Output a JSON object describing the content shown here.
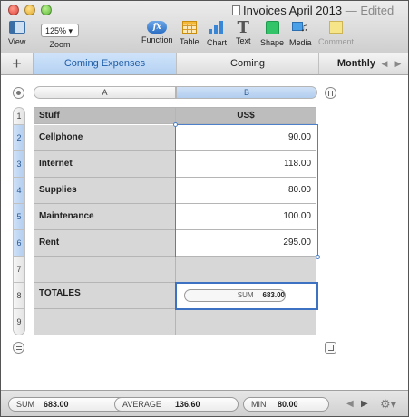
{
  "window": {
    "title": "Invoices April 2013",
    "status": "— Edited"
  },
  "toolbar": {
    "view_label": "View",
    "zoom_value": "125% ▾",
    "zoom_label": "Zoom",
    "function_label": "Function",
    "function_glyph": "fx",
    "table_label": "Table",
    "chart_label": "Chart",
    "text_label": "Text",
    "text_glyph": "T",
    "shape_label": "Shape",
    "media_label": "Media",
    "comment_label": "Comment"
  },
  "tabs": {
    "add_glyph": "+",
    "items": [
      {
        "label": "Coming Expenses",
        "active": true
      },
      {
        "label": "Coming",
        "active": false
      },
      {
        "label": "Monthly",
        "active": false
      }
    ],
    "prev_glyph": "◀",
    "next_glyph": "▶"
  },
  "sheet": {
    "columns": [
      "A",
      "B"
    ],
    "rows": [
      "1",
      "2",
      "3",
      "4",
      "5",
      "6",
      "7",
      "8",
      "9"
    ],
    "header": {
      "stuff": "Stuff",
      "currency": "US$"
    },
    "items": [
      {
        "name": "Cellphone",
        "amount": "90.00"
      },
      {
        "name": "Internet",
        "amount": "118.00"
      },
      {
        "name": "Supplies",
        "amount": "80.00"
      },
      {
        "name": "Maintenance",
        "amount": "100.00"
      },
      {
        "name": "Rent",
        "amount": "295.00"
      }
    ],
    "totals_label": "TOTALES",
    "totals_formula": {
      "fn": "SUM",
      "value": "683.00"
    }
  },
  "status": {
    "sum": {
      "label": "SUM",
      "value": "683.00"
    },
    "average": {
      "label": "AVERAGE",
      "value": "136.60"
    },
    "min": {
      "label": "MIN",
      "value": "80.00"
    },
    "prev_glyph": "◀",
    "next_glyph": "▶",
    "gear_glyph": "⚙▾"
  },
  "colors": {
    "accent": "#4d80c9",
    "tab_active": "#b4d1f2",
    "cell_gray": "#d7d7d7"
  }
}
